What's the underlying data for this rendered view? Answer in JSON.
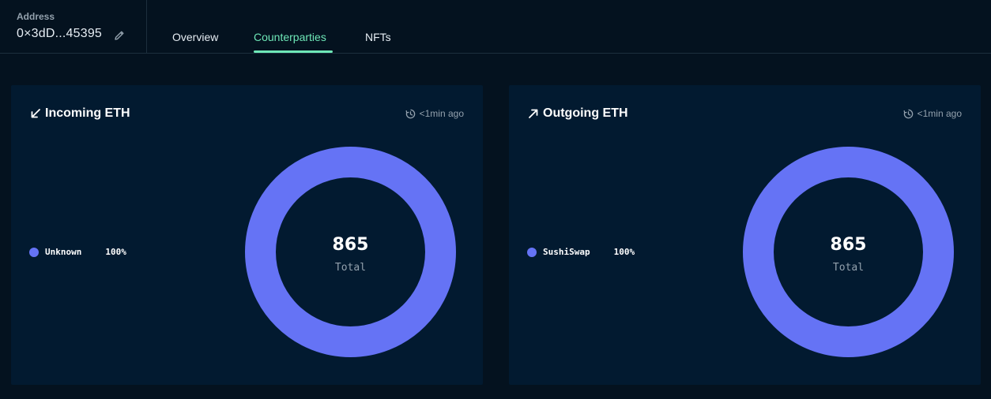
{
  "header": {
    "address_label": "Address",
    "address_value": "0×3dD...45395",
    "tabs": [
      {
        "label": "Overview",
        "active": false
      },
      {
        "label": "Counterparties",
        "active": true
      },
      {
        "label": "NFTs",
        "active": false
      }
    ],
    "accent_color": "#6ee7b7"
  },
  "cards": [
    {
      "title": "Incoming ETH",
      "arrow_icon": "arrow-down-left-icon",
      "updated": "<1min ago",
      "legend": [
        {
          "name": "Unknown",
          "percent": "100%",
          "color": "#6573f5"
        }
      ],
      "total_value": "865",
      "total_caption": "Total"
    },
    {
      "title": "Outgoing ETH",
      "arrow_icon": "arrow-up-right-icon",
      "updated": "<1min ago",
      "legend": [
        {
          "name": "SushiSwap",
          "percent": "100%",
          "color": "#6573f5"
        }
      ],
      "total_value": "865",
      "total_caption": "Total"
    }
  ],
  "chart_data": [
    {
      "type": "pie",
      "title": "Incoming ETH",
      "categories": [
        "Unknown"
      ],
      "values": [
        100
      ],
      "total": 865
    },
    {
      "type": "pie",
      "title": "Outgoing ETH",
      "categories": [
        "SushiSwap"
      ],
      "values": [
        100
      ],
      "total": 865
    }
  ]
}
